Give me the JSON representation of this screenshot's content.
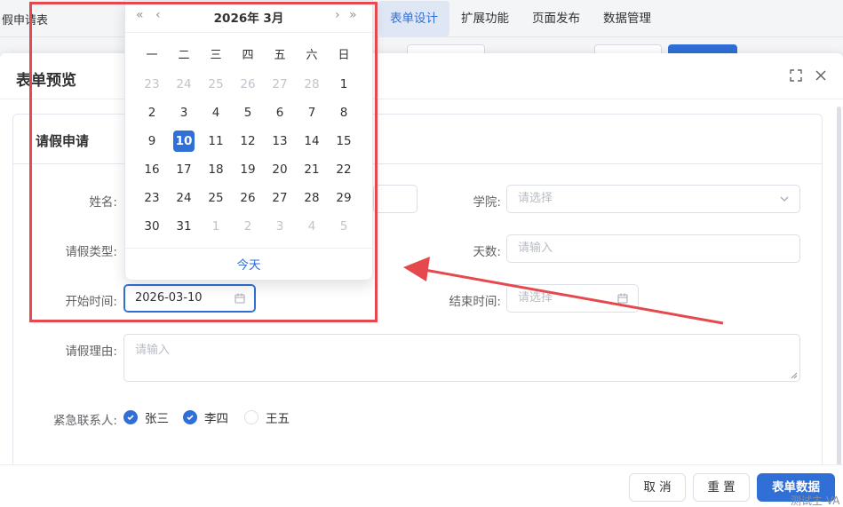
{
  "app": {
    "title": "假申请表",
    "nav": [
      "表单设计",
      "扩展功能",
      "页面发布",
      "数据管理"
    ],
    "active_nav": "表单设计"
  },
  "modal": {
    "title": "表单预览",
    "card_title": "请假申请"
  },
  "form": {
    "name_label": "姓名:",
    "college_label": "学院:",
    "college_placeholder": "请选择",
    "leave_type_label": "请假类型:",
    "days_label": "天数:",
    "days_placeholder": "请输入",
    "start_label": "开始时间:",
    "start_value": "2026-03-10",
    "end_label": "结束时间:",
    "end_placeholder": "请选择",
    "reason_label": "请假理由:",
    "reason_placeholder": "请输入",
    "contact_label": "紧急联系人:",
    "contacts": [
      {
        "name": "张三",
        "checked": true
      },
      {
        "name": "李四",
        "checked": true
      },
      {
        "name": "王五",
        "checked": false
      }
    ]
  },
  "footer": {
    "cancel": "取 消",
    "reset": "重 置",
    "submit": "表单数据"
  },
  "datepicker": {
    "title": "2026年  3月",
    "weekdays": [
      "一",
      "二",
      "三",
      "四",
      "五",
      "六",
      "日"
    ],
    "days": [
      [
        "23",
        "24",
        "25",
        "26",
        "27",
        "28",
        "1"
      ],
      [
        "2",
        "3",
        "4",
        "5",
        "6",
        "7",
        "8"
      ],
      [
        "9",
        "10",
        "11",
        "12",
        "13",
        "14",
        "15"
      ],
      [
        "16",
        "17",
        "18",
        "19",
        "20",
        "21",
        "22"
      ],
      [
        "23",
        "24",
        "25",
        "26",
        "27",
        "28",
        "29"
      ],
      [
        "30",
        "31",
        "1",
        "2",
        "3",
        "4",
        "5"
      ]
    ],
    "selected": "10",
    "today": "今天"
  },
  "watermark": "测试主 VA",
  "colors": {
    "accent": "#2f6fd6",
    "annotation": "#e5484d"
  }
}
